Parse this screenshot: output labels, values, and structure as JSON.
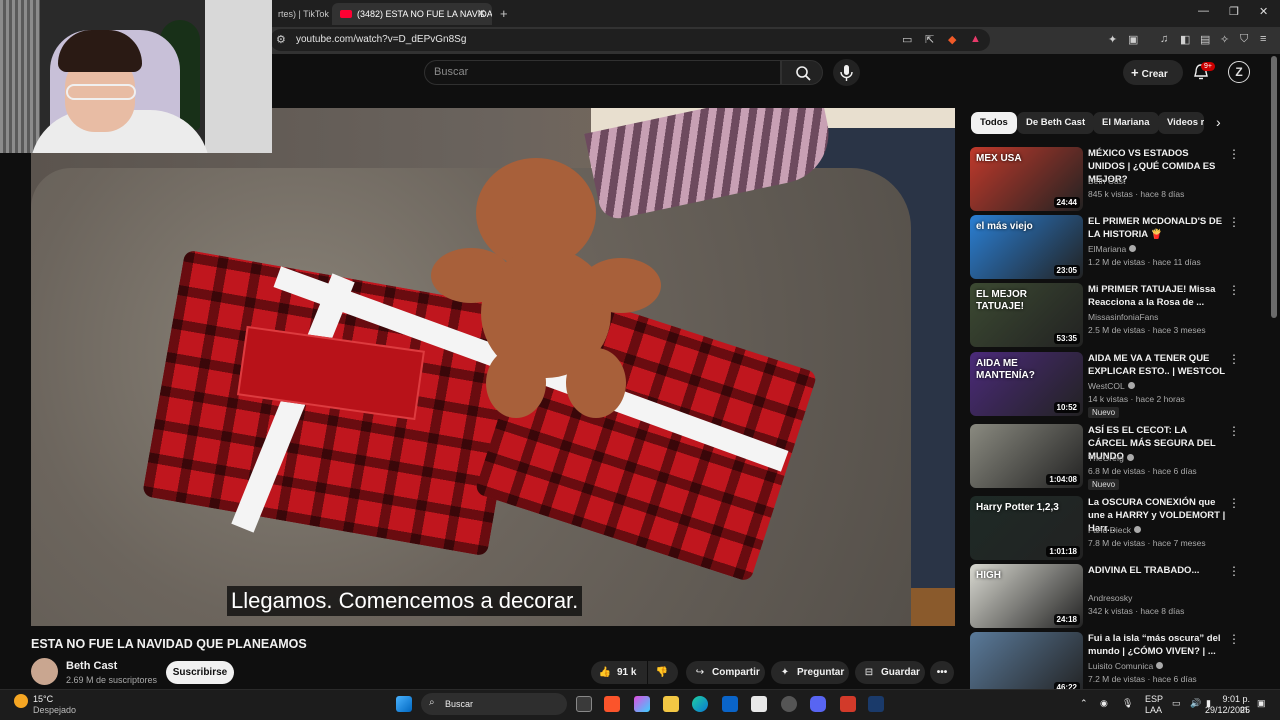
{
  "browser": {
    "tabs": [
      {
        "label": "rtes) | TikTok"
      },
      {
        "label": "(3482) ESTA NO FUE LA NAVIDAD"
      }
    ],
    "new_tab": "+",
    "url": "youtube.com/watch?v=D_dEPvGn8Sg"
  },
  "youtube": {
    "search_placeholder": "Buscar",
    "create_label": "Crear",
    "notif_badge": "9+",
    "user_initial": "Z"
  },
  "video": {
    "subtitle": "Llegamos. Comencemos a decorar.",
    "title": "ESTA NO FUE LA NAVIDAD QUE PLANEAMOS",
    "channel": "Beth Cast",
    "subscribers": "2.69 M de suscriptores",
    "subscribe_label": "Suscribirse",
    "likes": "91 k",
    "share_label": "Compartir",
    "ask_label": "Preguntar",
    "save_label": "Guardar"
  },
  "chips": [
    "Todos",
    "De Beth Cast",
    "El Mariana",
    "Videos r"
  ],
  "recommendations": [
    {
      "title": "MÉXICO VS ESTADOS UNIDOS | ¿QUÉ COMIDA ES MEJOR?",
      "channel": "Beth Cast",
      "meta": "845 k vistas · hace 8 días",
      "duration": "24:44",
      "thumb_text": "MEX   USA",
      "thumb_color": "#c0392b",
      "verified": false,
      "new": ""
    },
    {
      "title": "EL PRIMER MCDONALD'S DE LA HISTORIA 🍟",
      "channel": "ElMariana",
      "meta": "1.2 M de vistas · hace 11 días",
      "duration": "23:05",
      "thumb_text": "el más viejo",
      "thumb_color": "#2a7fd4",
      "verified": true,
      "new": ""
    },
    {
      "title": "Mi PRIMER TATUAJE! Missa Reacciona a la Rosa de ...",
      "channel": "MissasinfoniaFans",
      "meta": "2.5 M de vistas · hace 3 meses",
      "duration": "53:35",
      "thumb_text": "EL MEJOR TATUAJE!",
      "thumb_color": "#3c4a32",
      "verified": false,
      "new": ""
    },
    {
      "title": "AIDA ME VA A TENER QUE EXPLICAR ESTO.. | WESTCOL",
      "channel": "WestCOL",
      "meta": "14 k vistas · hace 2 horas",
      "duration": "10:52",
      "thumb_text": "AIDA ME MANTENÍA?",
      "thumb_color": "#4b2a7a",
      "verified": true,
      "new": "Nuevo"
    },
    {
      "title": "ASÍ ES EL CECOT: LA CÁRCEL MÁS SEGURA DEL MUNDO",
      "channel": "TheGrefg",
      "meta": "6.8 M de vistas · hace 6 días",
      "duration": "1:04:08",
      "thumb_text": "",
      "thumb_color": "#8a8a80",
      "verified": true,
      "new": "Nuevo"
    },
    {
      "title": "La OSCURA CONEXIÓN que une a HARRY y VOLDEMORT | Harr...",
      "channel": "Farid Dieck",
      "meta": "7.8 M de vistas · hace 7 meses",
      "duration": "1:01:18",
      "thumb_text": "Harry Potter 1,2,3",
      "thumb_color": "#1e2a26",
      "verified": true,
      "new": ""
    },
    {
      "title": "ADIVINA EL TRABADO...",
      "channel": "Andresosky",
      "meta": "342 k vistas · hace 8 días",
      "duration": "24:18",
      "thumb_text": "HIGH",
      "thumb_color": "#d8d8d0",
      "verified": false,
      "new": ""
    },
    {
      "title": "Fui a la isla “más oscura” del mundo | ¿CÓMO VIVEN? | ...",
      "channel": "Luisito Comunica",
      "meta": "7.2 M de vistas · hace 6 días",
      "duration": "46:22",
      "thumb_text": "",
      "thumb_color": "#5a7a9a",
      "verified": true,
      "new": ""
    }
  ],
  "taskbar": {
    "weather_temp": "15°C",
    "weather_desc": "Despejado",
    "search": "Buscar",
    "lang": "ESP",
    "lang2": "LAA",
    "time": "9:01 p. m.",
    "date": "29/12/2025"
  }
}
